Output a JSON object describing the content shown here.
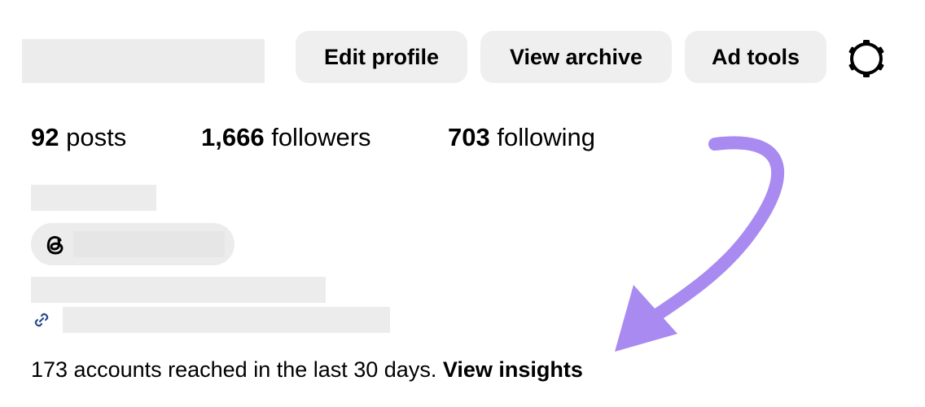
{
  "header": {
    "edit_profile_label": "Edit profile",
    "view_archive_label": "View archive",
    "ad_tools_label": "Ad tools",
    "settings_icon": "gear-icon"
  },
  "stats": {
    "posts_count": "92",
    "posts_label": "posts",
    "followers_count": "1,666",
    "followers_label": "followers",
    "following_count": "703",
    "following_label": "following"
  },
  "bio": {
    "threads_icon": "threads-icon",
    "link_icon": "link-icon"
  },
  "insights": {
    "reach_text": "173 accounts reached in the last 30 days.",
    "link_label": "View insights"
  },
  "colors": {
    "button_bg": "#efefef",
    "placeholder": "#ececec",
    "arrow": "#a98af0",
    "link_icon": "#2b4a8c"
  }
}
